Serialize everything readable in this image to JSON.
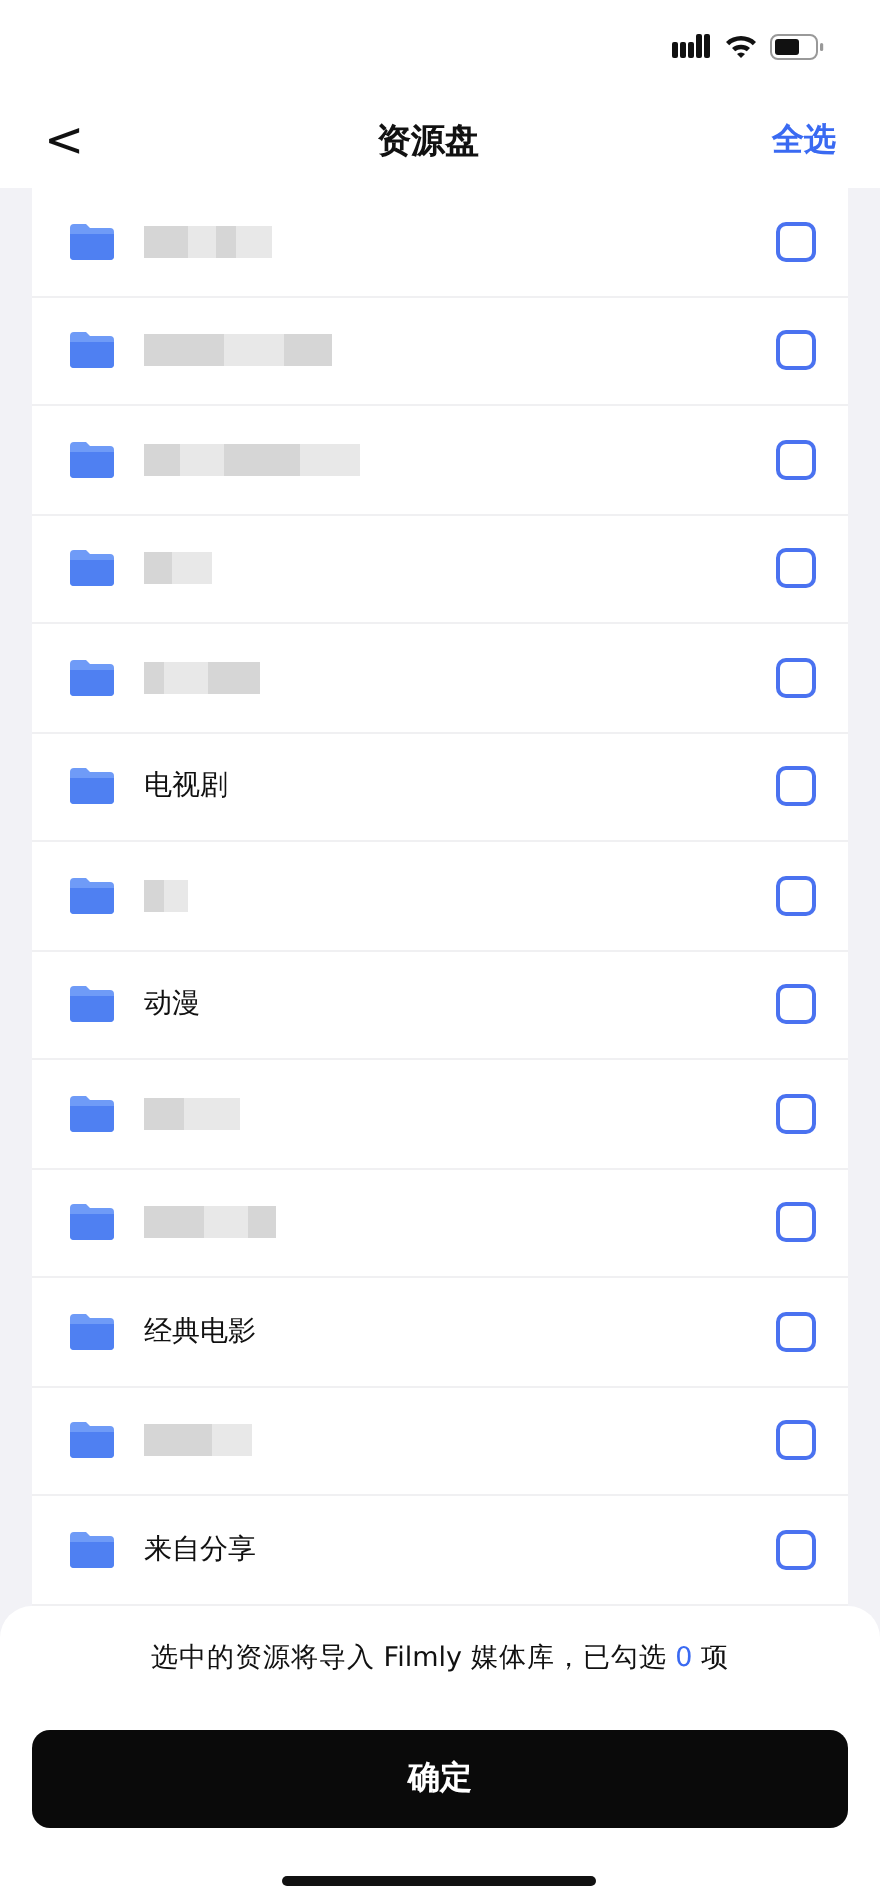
{
  "nav": {
    "back": "<",
    "title": "资源盘",
    "action": "全选"
  },
  "folders": [
    {
      "kind": "blurred",
      "checked": false
    },
    {
      "kind": "blurred",
      "checked": false
    },
    {
      "kind": "blurred",
      "checked": false
    },
    {
      "kind": "blurred",
      "checked": false
    },
    {
      "kind": "blurred",
      "checked": false
    },
    {
      "kind": "named",
      "name": "电视剧",
      "checked": false
    },
    {
      "kind": "blurred",
      "checked": false
    },
    {
      "kind": "named",
      "name": "动漫",
      "checked": false
    },
    {
      "kind": "blurred",
      "checked": false
    },
    {
      "kind": "blurred",
      "checked": false
    },
    {
      "kind": "named",
      "name": "经典电影",
      "checked": false
    },
    {
      "kind": "blurred",
      "checked": false
    },
    {
      "kind": "named",
      "name": "来自分享",
      "checked": false
    }
  ],
  "summary": {
    "before": "选中的资源将导入 Filmly 媒体库，已勾选",
    "count": "0",
    "after": "项"
  },
  "confirm": "确定"
}
